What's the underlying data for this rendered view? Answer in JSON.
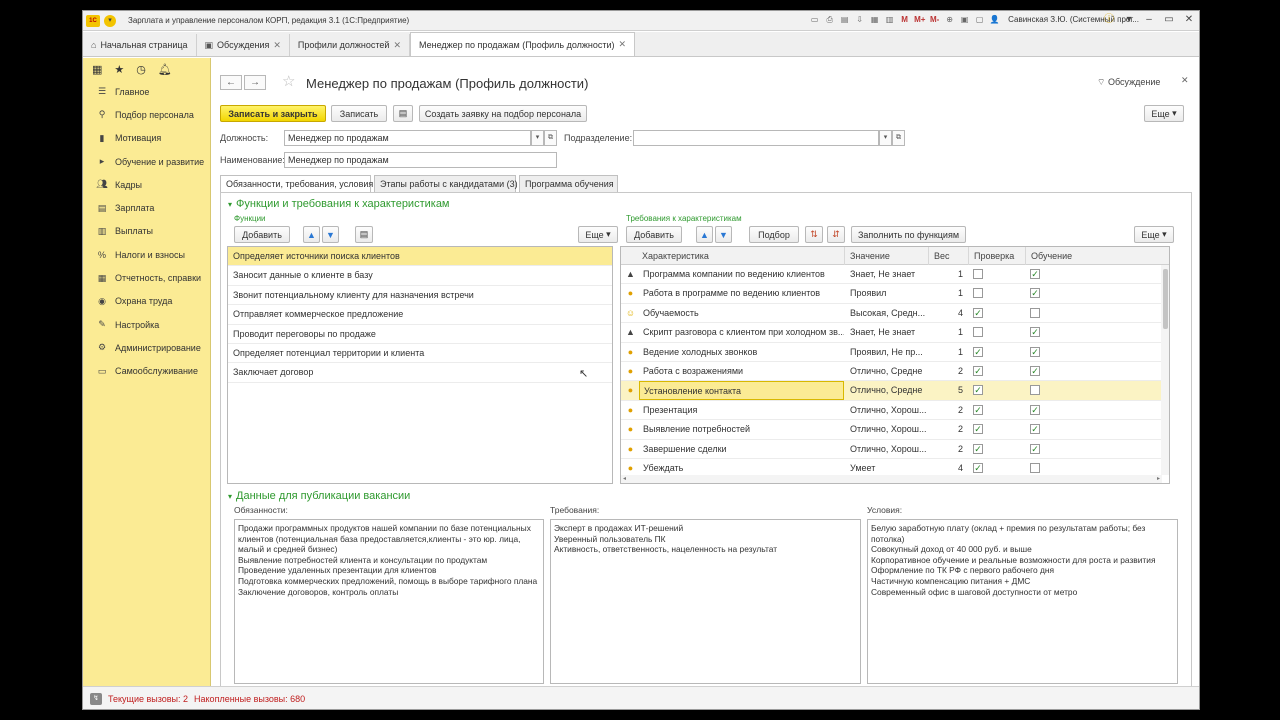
{
  "window": {
    "title": "Зарплата и управление персоналом КОРП, редакция 3.1  (1С:Предприятие)",
    "logo_text": "1С",
    "user": "Савинская З.Ю. (Системный прог...",
    "tool_icons": [
      "M",
      "M+",
      "M-"
    ]
  },
  "tabs": [
    {
      "label": "Начальная страница",
      "closable": false
    },
    {
      "label": "Обсуждения",
      "closable": true
    },
    {
      "label": "Профили должностей",
      "closable": true
    },
    {
      "label": "Менеджер  по продажам (Профиль должности)",
      "closable": true
    }
  ],
  "sidebar": {
    "items": [
      {
        "label": "Главное",
        "icon": "menu-icon"
      },
      {
        "label": "Подбор персонала",
        "icon": "recruit-icon"
      },
      {
        "label": "Мотивация",
        "icon": "motivation-icon"
      },
      {
        "label": "Обучение и развитие",
        "icon": "training-icon"
      },
      {
        "label": "Кадры",
        "icon": "people-icon"
      },
      {
        "label": "Зарплата",
        "icon": "salary-icon"
      },
      {
        "label": "Выплаты",
        "icon": "payments-icon"
      },
      {
        "label": "Налоги и взносы",
        "icon": "percent-icon"
      },
      {
        "label": "Отчетность, справки",
        "icon": "reports-icon"
      },
      {
        "label": "Охрана труда",
        "icon": "safety-icon"
      },
      {
        "label": "Настройка",
        "icon": "wrench-icon"
      },
      {
        "label": "Администрирование",
        "icon": "gear-icon"
      },
      {
        "label": "Самообслуживание",
        "icon": "self-service-icon"
      }
    ]
  },
  "form": {
    "title": "Менеджер  по продажам (Профиль должности)",
    "discussion_label": "Обсуждение",
    "buttons": {
      "save_close": "Записать и закрыть",
      "save": "Записать",
      "create_request": "Создать заявку на подбор персонала",
      "more": "Еще"
    },
    "fields": {
      "position_label": "Должность:",
      "position_value": "Менеджер по продажам",
      "department_label": "Подразделение:",
      "department_value": "",
      "name_label": "Наименование:",
      "name_value": "Менеджер  по продажам"
    },
    "form_tabs": [
      "Обязанности, требования, условия",
      "Этапы работы с кандидатами (3)",
      "Программа обучения"
    ]
  },
  "functions_section": {
    "title": "Функции и требования к характеристикам",
    "functions_label": "Функции",
    "add_button": "Добавить",
    "more_button": "Еще",
    "items": [
      "Определяет источники поиска клиентов",
      "Заносит данные о клиенте в базу",
      "Звонит потенциальному клиенту для назначения встречи",
      "Отправляет коммерческое предложение",
      "Проводит переговоры по продаже",
      "Определяет потенциал территории и клиента",
      "Заключает договор"
    ]
  },
  "requirements": {
    "label": "Требования к характеристикам",
    "add_button": "Добавить",
    "pick_button": "Подбор",
    "fill_button": "Заполнить по функциям",
    "more_button": "Еще",
    "columns": [
      "Характеристика",
      "Значение",
      "Вес",
      "Проверка",
      "Обучение"
    ],
    "rows": [
      {
        "icon": "cap",
        "name": "Программа компании по ведению клиентов",
        "value": "Знает, Не знает",
        "weight": "1",
        "check": false,
        "training": true
      },
      {
        "icon": "bulb",
        "name": "Работа в программе по ведению клиентов",
        "value": "Проявил",
        "weight": "1",
        "check": false,
        "training": true
      },
      {
        "icon": "smile",
        "name": "Обучаемость",
        "value": "Высокая, Средн...",
        "weight": "4",
        "check": true,
        "training": false
      },
      {
        "icon": "cap",
        "name": "Скрипт разговора с клиентом при холодном зв...",
        "value": "Знает, Не знает",
        "weight": "1",
        "check": false,
        "training": true
      },
      {
        "icon": "bulb",
        "name": "Ведение холодных звонков",
        "value": "Проявил, Не пр...",
        "weight": "1",
        "check": true,
        "training": true
      },
      {
        "icon": "bulb",
        "name": "Работа с возражениями",
        "value": "Отлично, Средне",
        "weight": "2",
        "check": true,
        "training": true
      },
      {
        "icon": "bulb",
        "name": "Установление контакта",
        "value": "Отлично, Средне",
        "weight": "5",
        "check": true,
        "training": false
      },
      {
        "icon": "bulb",
        "name": "Презентация",
        "value": "Отлично, Хорош...",
        "weight": "2",
        "check": true,
        "training": true
      },
      {
        "icon": "bulb",
        "name": "Выявление потребностей",
        "value": "Отлично, Хорош...",
        "weight": "2",
        "check": true,
        "training": true
      },
      {
        "icon": "bulb",
        "name": "Завершение сделки",
        "value": "Отлично, Хорош...",
        "weight": "2",
        "check": true,
        "training": true
      },
      {
        "icon": "bulb",
        "name": "Убеждать",
        "value": "Умеет",
        "weight": "4",
        "check": true,
        "training": false
      }
    ],
    "selected_row": 6
  },
  "vacancy_section": {
    "title": "Данные для публикации вакансии",
    "duties_label": "Обязанности:",
    "duties": [
      "Продажи программных продуктов нашей компании по базе потенциальных клиентов (потенциальная база предоставляется,клиенты - это юр. лица, малый и средней бизнес)",
      "Выявление потребностей клиента и консультации по продуктам",
      "Проведение удаленных презентации для клиентов",
      "Подготовка коммерческих предложений, помощь в выборе тарифного плана",
      "Заключение договоров, контроль оплаты"
    ],
    "requirements_label": "Требования:",
    "requirements": [
      "Эксперт в продажах ИТ-решений",
      "Уверенный пользователь ПК",
      "Активность, ответственность, нацеленность на результат"
    ],
    "conditions_label": "Условия:",
    "conditions": [
      "Белую заработную плату (оклад + премия по результатам работы; без потолка)",
      "Совокупный доход от 40 000 руб. и выше",
      "Корпоративное обучение и реальные возможности для роста и развития",
      "Оформление по ТК РФ с первого рабочего дня",
      "Частичную компенсацию питания + ДМС",
      "Современный офис в шаговой доступности от метро"
    ]
  },
  "status": {
    "current_calls": "Текущие вызовы: 2",
    "accumulated_calls": "Накопленные вызовы: 680"
  }
}
